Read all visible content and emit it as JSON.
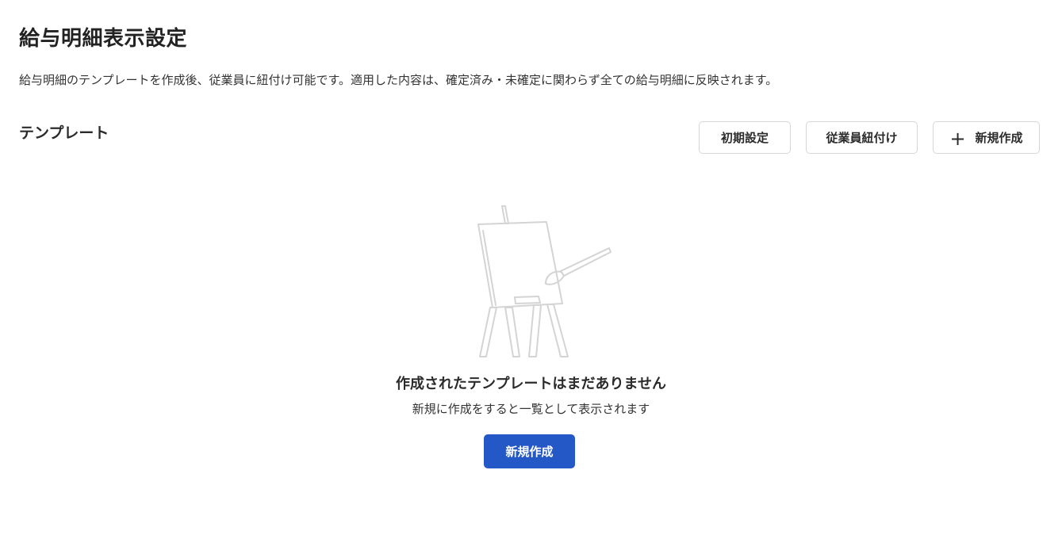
{
  "header": {
    "title": "給与明細表示設定",
    "description": "給与明細のテンプレートを作成後、従業員に紐付け可能です。適用した内容は、確定済み・未確定に関わらず全ての給与明細に反映されます。"
  },
  "templates": {
    "section_title": "テンプレート",
    "toolbar": {
      "initial_settings_label": "初期設定",
      "employee_assign_label": "従業員紐付け",
      "new_create_icon": "plus-icon",
      "new_create_label": "新規作成"
    }
  },
  "empty_state": {
    "illustration_icon": "easel-icon",
    "title": "作成されたテンプレートはまだありません",
    "subtitle": "新規に作成をすると一覧として表示されます",
    "button_label": "新規作成"
  },
  "colors": {
    "primary": "#2458c6",
    "border": "#d6d6d6",
    "illustration_stroke": "#d4d4d4"
  }
}
